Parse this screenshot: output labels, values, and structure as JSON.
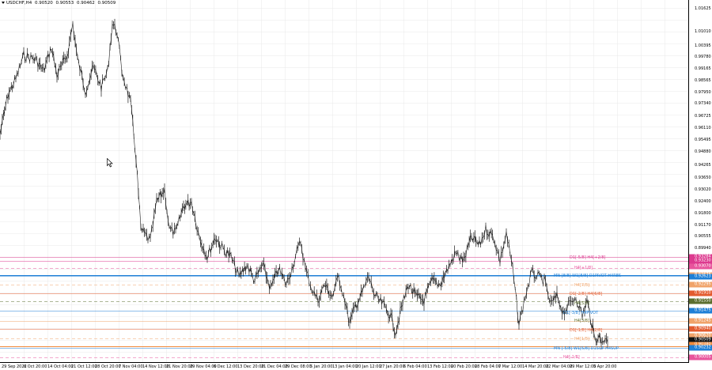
{
  "header": {
    "symbol": "USDCHF,H4",
    "open": "0.90520",
    "high": "0.90553",
    "low": "0.90462",
    "close": "0.90509"
  },
  "price_axis": {
    "labels": [
      "1.01625",
      "1.01010",
      "1.00395",
      "0.99780",
      "0.99165",
      "0.98565",
      "0.97950",
      "0.97340",
      "0.96725",
      "0.96110",
      "0.95495",
      "0.94880",
      "0.94265",
      "0.93650",
      "0.93020",
      "0.92400",
      "0.91800",
      "0.91170",
      "0.90555",
      "0.89940"
    ],
    "tags": [
      {
        "text": "0.93284",
        "color": "#dd3a8f"
      },
      {
        "text": "0.93230",
        "color": "#dd3a8f"
      },
      {
        "text": "0.93070",
        "color": "#e8549c"
      },
      {
        "text": "0.92670",
        "color": "#f0a36a"
      },
      {
        "text": "0.92623",
        "color": "#1e7fd6"
      },
      {
        "text": "0.92295",
        "color": "#f0a36a"
      },
      {
        "text": "0.91910",
        "color": "#e35b2f"
      },
      {
        "text": "0.91550",
        "color": "#5b6e2e"
      },
      {
        "text": "0.91475",
        "color": "#1e7fd6"
      },
      {
        "text": "0.91245",
        "color": "#f0a36a"
      },
      {
        "text": "0.90940",
        "color": "#e35b2f"
      },
      {
        "text": "0.90620",
        "color": "#f0a36a"
      },
      {
        "text": "0.90509",
        "color": "#111111"
      },
      {
        "text": "0.90380",
        "color": "#f08a3c"
      },
      {
        "text": "0.90232",
        "color": "#1e7fd6"
      },
      {
        "text": "0.90005",
        "color": "#e8549c"
      }
    ]
  },
  "levels": [
    {
      "text": "D1[-5/8]  H4[+2/8]",
      "color": "#dd3a8f"
    },
    {
      "text": "H4[+1/8]",
      "color": "#e8549c"
    },
    {
      "text": "MN [8/8]  W1[8/8]  D1PIVOT  H4RES",
      "color": "#1e7fd6"
    },
    {
      "text": "H4[7/8]",
      "color": "#f0a36a"
    },
    {
      "text": "D1[-2/8]  H4[6/8]",
      "color": "#e35b2f"
    },
    {
      "text": "H4[5/8]",
      "color": "#5b6e2e"
    },
    {
      "text": "D1[-3/8]  H4PIVOT",
      "color": "#1e7fd6"
    },
    {
      "text": "H4[3/8]",
      "color": "#5b6e2e"
    },
    {
      "text": "D1[-1/8]  H4[2/8]",
      "color": "#e35b2f"
    },
    {
      "text": "H4[1/8]",
      "color": "#f0a36a"
    },
    {
      "text": "MN [-5/8]  W1[5/8]  D1SUP  H4SUP",
      "color": "#1e7fd6"
    },
    {
      "text": "H4[-1/8]",
      "color": "#e8549c"
    }
  ],
  "time_axis": [
    "29 Sep 2022",
    "6 Oct 20:00",
    "14 Oct 04:00",
    "21 Oct 12:00",
    "28 Oct 20:00",
    "7 Nov 04:00",
    "14 Nov 12:00",
    "21 Nov 20:00",
    "29 Nov 04:00",
    "6 Dec 12:00",
    "13 Dec 20:00",
    "21 Dec 04:00",
    "29 Dec 08:00",
    "5 Jan 20:00",
    "13 Jan 04:00",
    "20 Jan 12:00",
    "27 Jan 20:00",
    "6 Feb 04:00",
    "13 Feb 12:00",
    "20 Feb 20:00",
    "28 Feb 04:00",
    "7 Mar 12:00",
    "14 Mar 20:00",
    "22 Mar 04:00",
    "29 Mar 12:00",
    "5 Apr 20:00"
  ],
  "colors": {
    "background": "#ffffff",
    "grid": "#e9e9e9",
    "price_series": "#1a1a1a",
    "current_price": "#111111"
  }
}
